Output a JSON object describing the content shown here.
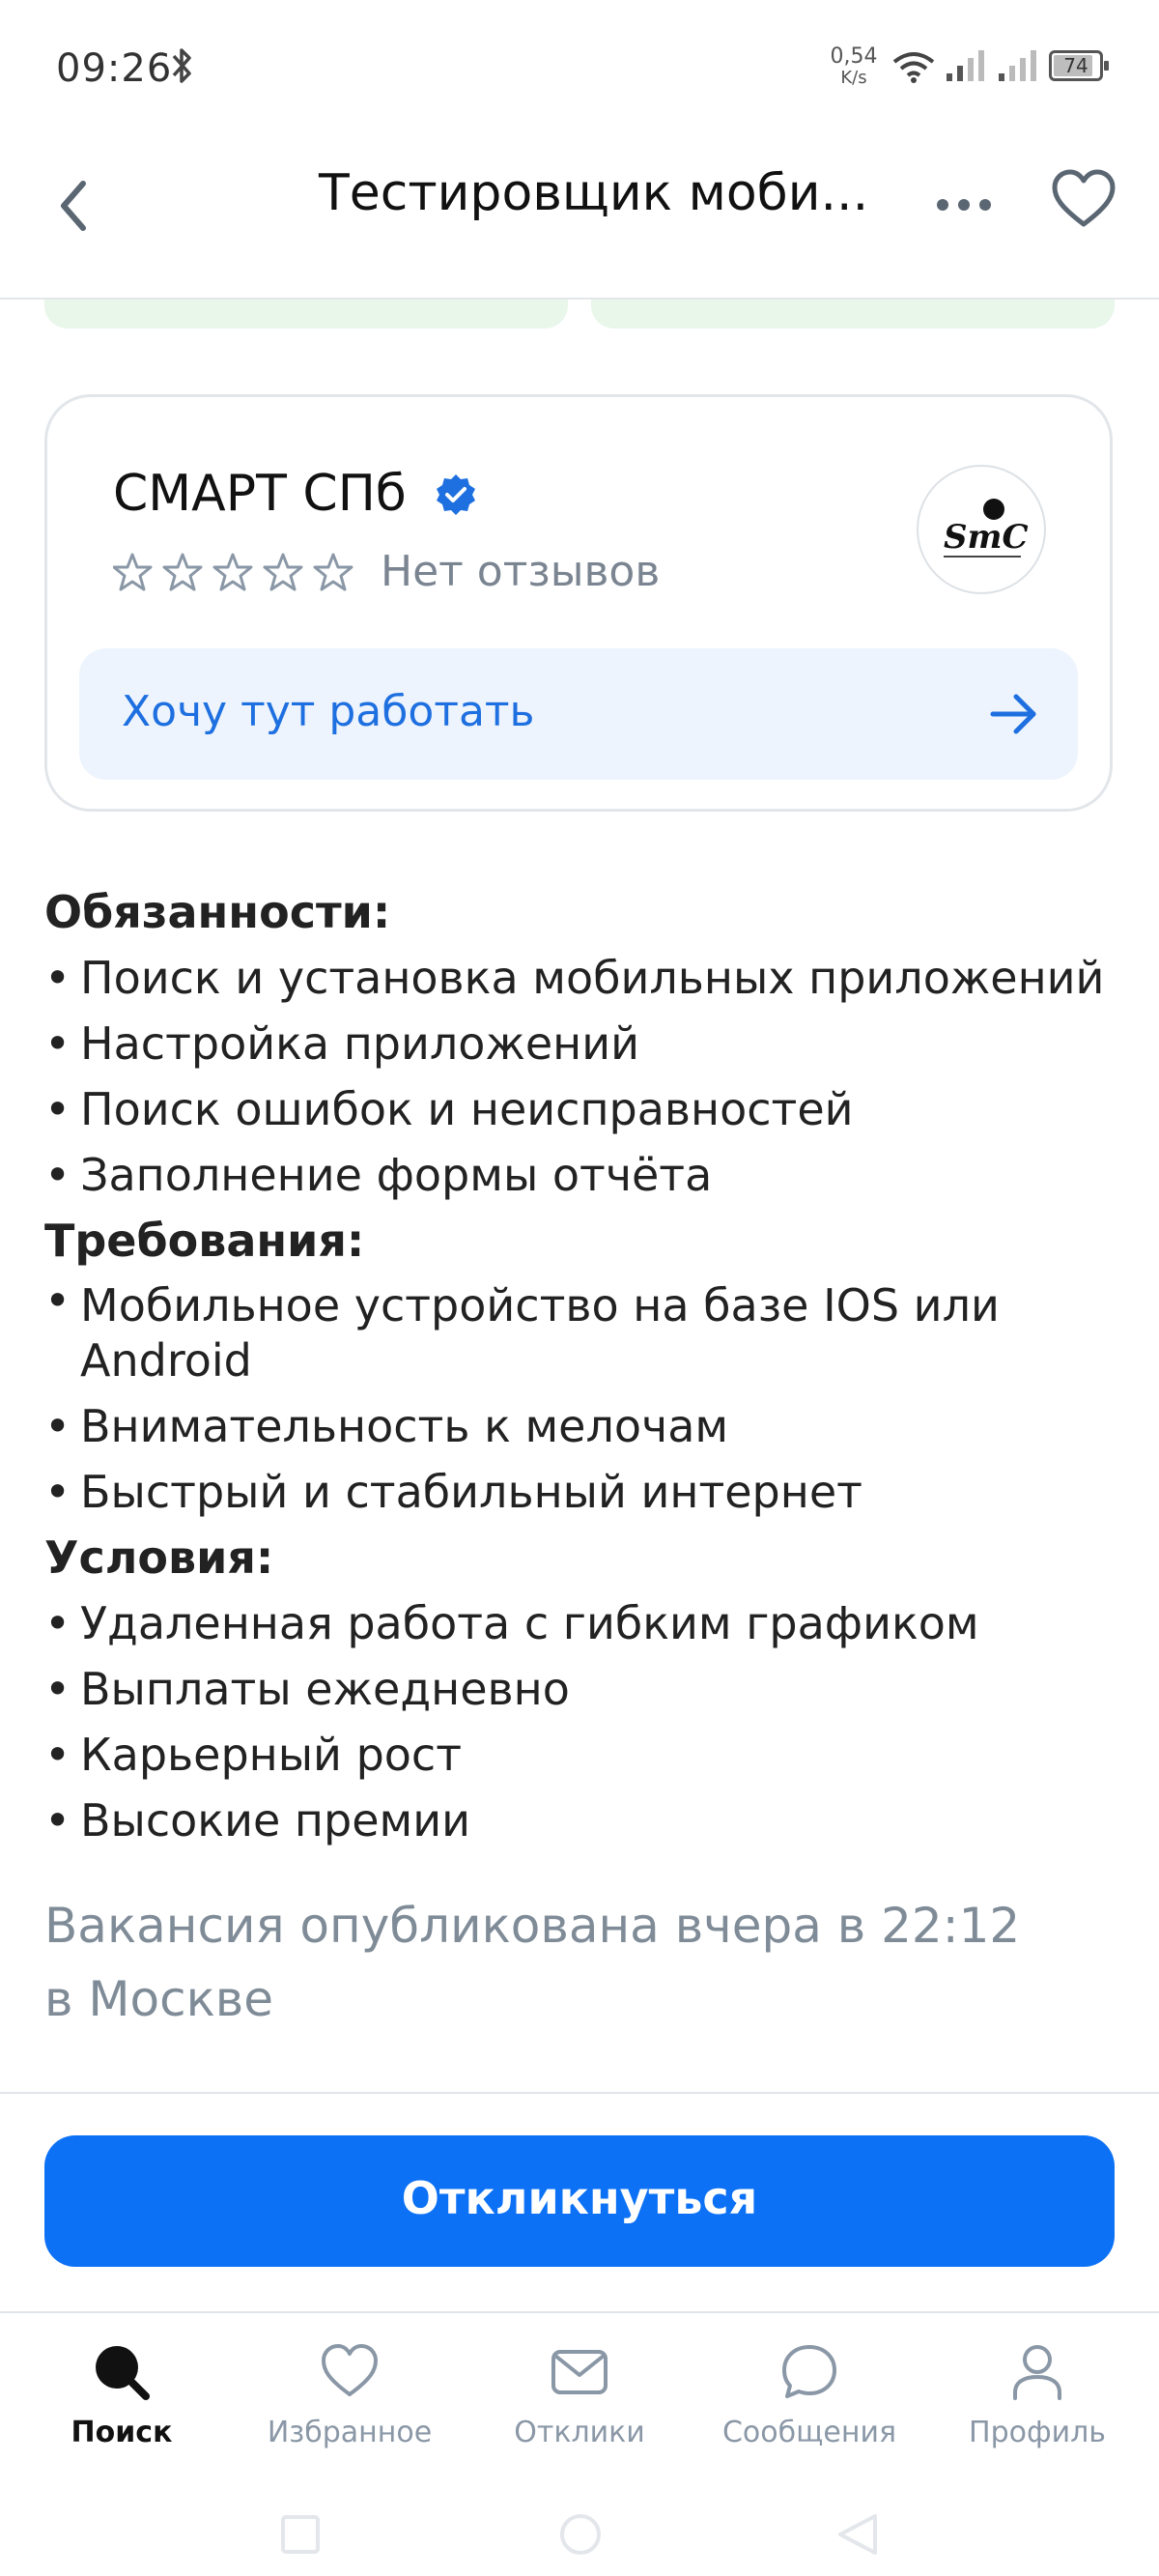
{
  "status_bar": {
    "time": "09:26",
    "net_speed_value": "0,54",
    "net_speed_unit": "K/s",
    "battery": "74"
  },
  "header": {
    "title": "Тестировщик моби..."
  },
  "company": {
    "name": "СМАРТ СПб",
    "verified": true,
    "rating_stars": 0,
    "reviews_text": "Нет отзывов",
    "logo_text": "SmC",
    "work_here_label": "Хочу тут работать"
  },
  "description": {
    "sections": [
      {
        "title": "Обязанности:",
        "items": [
          "Поиск и установка мобильных приложений",
          "Настройка приложений",
          "Поиск ошибок и неисправностей",
          "Заполнение формы отчёта"
        ]
      },
      {
        "title": "Требования:",
        "items": [
          "Мобильное устройство на базе IOS или Android",
          "Внимательность к мелочам",
          "Быстрый и стабильный интернет"
        ]
      },
      {
        "title": "Условия:",
        "items": [
          "Удаленная работа с гибким графиком",
          "Выплаты ежедневно",
          "Карьерный рост",
          "Высокие премии"
        ]
      }
    ]
  },
  "published": {
    "line1": "Вакансия опубликована вчера в 22:12",
    "line2": "в Москве"
  },
  "reply_button": "Откликнуться",
  "bottom_nav": [
    {
      "label": "Поиск",
      "icon": "search-icon",
      "active": true
    },
    {
      "label": "Избранное",
      "icon": "heart-icon",
      "active": false
    },
    {
      "label": "Отклики",
      "icon": "mail-icon",
      "active": false
    },
    {
      "label": "Сообщения",
      "icon": "chat-icon",
      "active": false
    },
    {
      "label": "Профиль",
      "icon": "profile-icon",
      "active": false
    }
  ],
  "colors": {
    "accent": "#0c71f5",
    "accent_light_bg": "#edf4fd",
    "muted_text": "#7f8c98",
    "chip_green": "#e9f6ea"
  }
}
